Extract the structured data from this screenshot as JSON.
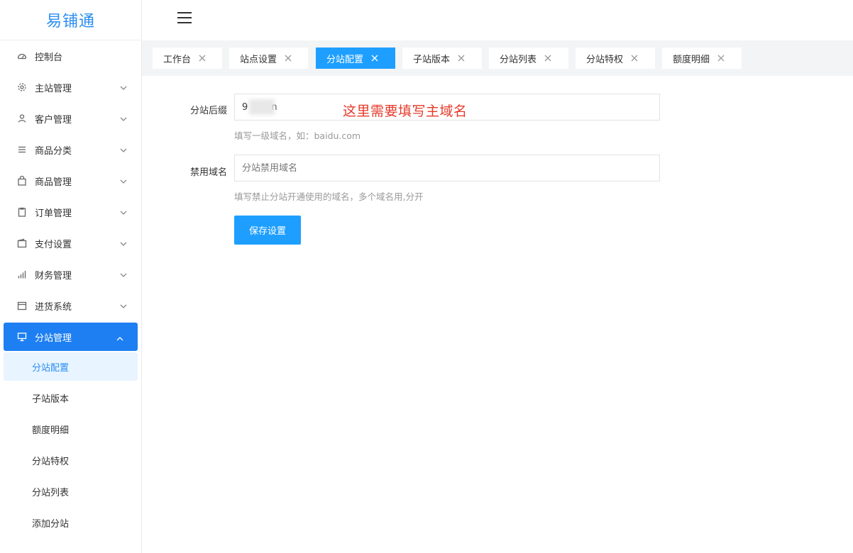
{
  "app": {
    "title": "易铺通"
  },
  "sidebar": {
    "items": [
      {
        "label": "控制台",
        "icon": "dashboard-icon"
      },
      {
        "label": "主站管理",
        "icon": "gear-icon"
      },
      {
        "label": "客户管理",
        "icon": "user-icon"
      },
      {
        "label": "商品分类",
        "icon": "list-icon"
      },
      {
        "label": "商品管理",
        "icon": "bag-icon"
      },
      {
        "label": "订单管理",
        "icon": "clipboard-icon"
      },
      {
        "label": "支付设置",
        "icon": "wallet-icon"
      },
      {
        "label": "财务管理",
        "icon": "bar-chart-icon"
      },
      {
        "label": "进货系统",
        "icon": "box-icon"
      },
      {
        "label": "分站管理",
        "icon": "monitor-icon"
      }
    ],
    "subitems": [
      {
        "label": "分站配置"
      },
      {
        "label": "子站版本"
      },
      {
        "label": "额度明细"
      },
      {
        "label": "分站特权"
      },
      {
        "label": "分站列表"
      },
      {
        "label": "添加分站"
      }
    ],
    "active_item": "分站管理",
    "active_subitem": "分站配置"
  },
  "tabs": [
    {
      "label": "工作台"
    },
    {
      "label": "站点设置"
    },
    {
      "label": "分站配置"
    },
    {
      "label": "子站版本"
    },
    {
      "label": "分站列表"
    },
    {
      "label": "分站特权"
    },
    {
      "label": "额度明细"
    }
  ],
  "active_tab": "分站配置",
  "form": {
    "suffix": {
      "label": "分站后缀",
      "value": "9        n",
      "hint": "填写一级域名，如：baidu.com"
    },
    "annotation": "这里需要填写主域名",
    "banned": {
      "label": "禁用域名",
      "placeholder": "分站禁用域名",
      "hint": "填写禁止分站开通使用的域名，多个域名用,分开"
    },
    "save_label": "保存设置"
  },
  "colors": {
    "brand": "#2a8ef0",
    "sidebar_active": "#1e7ff2",
    "tab_active": "#1e9fff",
    "button": "#1e9fff",
    "annotation": "#e53a2a",
    "submenu_active_bg": "#e8f4ff"
  }
}
